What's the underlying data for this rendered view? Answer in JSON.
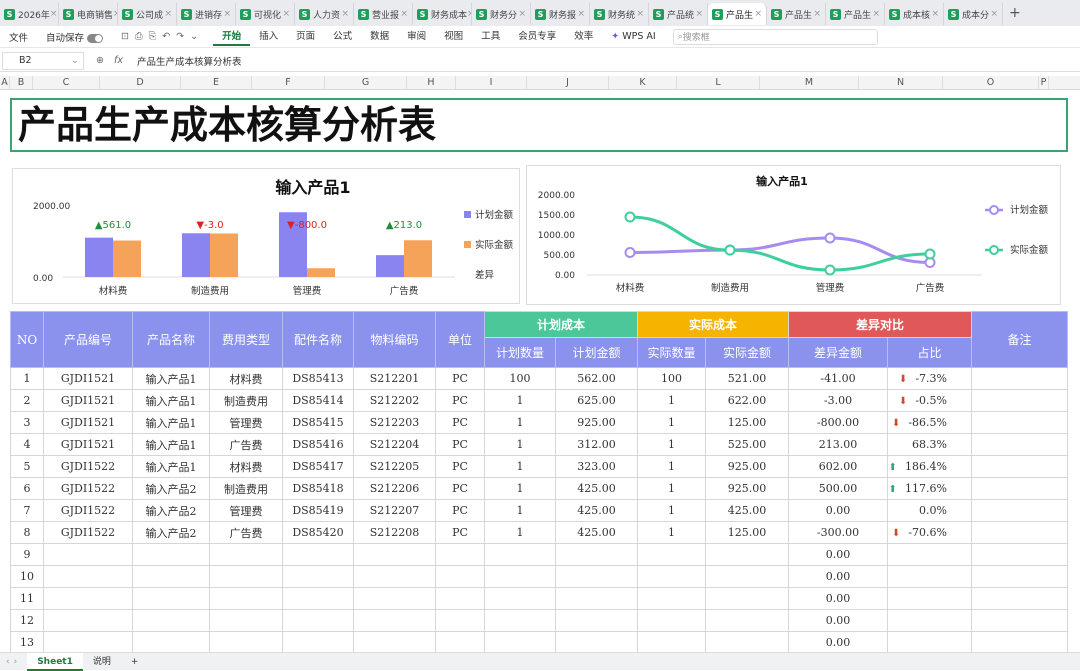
{
  "tabs": [
    "2026年",
    "电商销售",
    "公司成",
    "进销存",
    "可视化",
    "人力资",
    "营业报",
    "财务成本",
    "财务分",
    "财务报",
    "财务统",
    "产品统",
    "产品生",
    "产品生",
    "产品生",
    "成本核",
    "成本分"
  ],
  "active_tab": 12,
  "menu": {
    "file": "文件",
    "autosave": "自动保存",
    "items": [
      "开始",
      "插入",
      "页面",
      "公式",
      "数据",
      "审阅",
      "视图",
      "工具",
      "会员专享",
      "效率"
    ],
    "wps_ai": "WPS AI",
    "search_placeholder": "搜索框"
  },
  "formula": {
    "cell": "B2",
    "fx": "fx",
    "value": "产品生产成本核算分析表"
  },
  "columns": [
    "A",
    "B",
    "C",
    "D",
    "E",
    "F",
    "G",
    "H",
    "I",
    "J",
    "K",
    "L",
    "M",
    "N",
    "O",
    "P"
  ],
  "title": "产品生产成本核算分析表",
  "chart_data": [
    {
      "type": "bar",
      "title": "输入产品1",
      "categories": [
        "材料费",
        "制造费用",
        "管理费",
        "广告费"
      ],
      "series": [
        {
          "name": "计划金额",
          "values": [
            562,
            625,
            925,
            312
          ],
          "color": "#8a84f0"
        },
        {
          "name": "实际金额",
          "values": [
            521,
            622,
            125,
            525
          ],
          "color": "#f5a359"
        }
      ],
      "extra_legend": "差异",
      "yticks": [
        "2000.00",
        "0.00"
      ],
      "ylim": [
        0,
        2000
      ],
      "diff_labels": [
        {
          "arrow": "▲",
          "text": "561.0",
          "color": "#1f8f3a"
        },
        {
          "arrow": "▼",
          "text": "-3.0",
          "color": "#e02020"
        },
        {
          "arrow": "▼",
          "text": "-800.0",
          "color": "#e02020"
        },
        {
          "arrow": "▲",
          "text": "213.0",
          "color": "#1f8f3a"
        }
      ]
    },
    {
      "type": "line",
      "title": "输入产品1",
      "categories": [
        "材料费",
        "制造费用",
        "管理费",
        "广告费"
      ],
      "series": [
        {
          "name": "计划金额",
          "values": [
            562,
            625,
            925,
            312
          ],
          "color": "#a58cf0"
        },
        {
          "name": "实际金额",
          "values": [
            1450,
            622,
            125,
            525
          ],
          "color": "#3ecf9c"
        }
      ],
      "yticks": [
        "2000.00",
        "1500.00",
        "1000.00",
        "500.00",
        "0.00"
      ],
      "ylim": [
        0,
        2000
      ]
    }
  ],
  "table": {
    "h1": {
      "no": "NO",
      "code": "产品编号",
      "name": "产品名称",
      "type": "费用类型",
      "part": "配件名称",
      "mat": "物料编码",
      "unit": "单位",
      "plan": "计划成本",
      "act": "实际成本",
      "diff": "差异对比",
      "note": "备注"
    },
    "h2": {
      "pq": "计划数量",
      "pa": "计划金额",
      "aq": "实际数量",
      "aa": "实际金额",
      "da": "差异金额",
      "pct": "占比"
    },
    "rows": [
      [
        "1",
        "GJDI1521",
        "输入产品1",
        "材料费",
        "DS85413",
        "S212201",
        "PC",
        "100",
        "562.00",
        "100",
        "521.00",
        "-41.00",
        "down",
        "-7.3%"
      ],
      [
        "2",
        "GJDI1521",
        "输入产品1",
        "制造费用",
        "DS85414",
        "S212202",
        "PC",
        "1",
        "625.00",
        "1",
        "622.00",
        "-3.00",
        "down",
        "-0.5%"
      ],
      [
        "3",
        "GJDI1521",
        "输入产品1",
        "管理费",
        "DS85415",
        "S212203",
        "PC",
        "1",
        "925.00",
        "1",
        "125.00",
        "-800.00",
        "down",
        "-86.5%"
      ],
      [
        "4",
        "GJDI1521",
        "输入产品1",
        "广告费",
        "DS85416",
        "S212204",
        "PC",
        "1",
        "312.00",
        "1",
        "525.00",
        "213.00",
        "",
        "68.3%"
      ],
      [
        "5",
        "GJDI1522",
        "输入产品1",
        "材料费",
        "DS85417",
        "S212205",
        "PC",
        "1",
        "323.00",
        "1",
        "925.00",
        "602.00",
        "up",
        "186.4%"
      ],
      [
        "6",
        "GJDI1522",
        "输入产品2",
        "制造费用",
        "DS85418",
        "S212206",
        "PC",
        "1",
        "425.00",
        "1",
        "925.00",
        "500.00",
        "up",
        "117.6%"
      ],
      [
        "7",
        "GJDI1522",
        "输入产品2",
        "管理费",
        "DS85419",
        "S212207",
        "PC",
        "1",
        "425.00",
        "1",
        "425.00",
        "0.00",
        "",
        "0.0%"
      ],
      [
        "8",
        "GJDI1522",
        "输入产品2",
        "广告费",
        "DS85420",
        "S212208",
        "PC",
        "1",
        "425.00",
        "1",
        "125.00",
        "-300.00",
        "down",
        "-70.6%"
      ],
      [
        "9",
        "",
        "",
        "",
        "",
        "",
        "",
        "",
        "",
        "",
        "",
        "0.00",
        "",
        ""
      ],
      [
        "10",
        "",
        "",
        "",
        "",
        "",
        "",
        "",
        "",
        "",
        "",
        "0.00",
        "",
        ""
      ],
      [
        "11",
        "",
        "",
        "",
        "",
        "",
        "",
        "",
        "",
        "",
        "",
        "0.00",
        "",
        ""
      ],
      [
        "12",
        "",
        "",
        "",
        "",
        "",
        "",
        "",
        "",
        "",
        "",
        "0.00",
        "",
        ""
      ],
      [
        "13",
        "",
        "",
        "",
        "",
        "",
        "",
        "",
        "",
        "",
        "",
        "0.00",
        "",
        ""
      ]
    ]
  },
  "sheets": [
    "Sheet1",
    "说明"
  ],
  "add_sheet": "+"
}
